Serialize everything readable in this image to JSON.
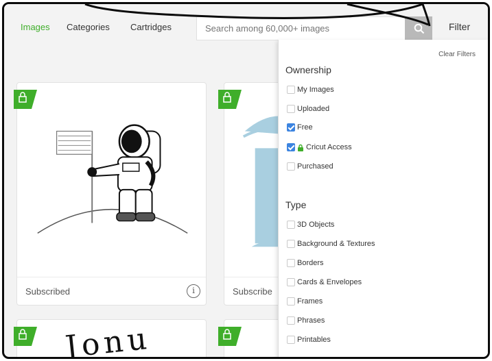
{
  "nav": {
    "tabs": [
      {
        "label": "Images",
        "active": true
      },
      {
        "label": "Categories",
        "active": false
      },
      {
        "label": "Cartridges",
        "active": false
      }
    ],
    "search_placeholder": "Search among 60,000+ images",
    "filter_label": "Filter",
    "search_icon": "search-icon"
  },
  "cards": [
    {
      "status": "Subscribed",
      "art": "astronaut-with-flag",
      "badge": "lock-icon"
    },
    {
      "status": "Subscribe",
      "art": "tree-illustration",
      "badge": "lock-icon"
    },
    {
      "status": "",
      "art": "lettering",
      "badge": "lock-icon"
    },
    {
      "status": "",
      "art": "unknown",
      "badge": "lock-icon"
    }
  ],
  "filters": {
    "clear_label": "Clear Filters",
    "ownership": {
      "title": "Ownership",
      "options": [
        {
          "label": "My Images",
          "checked": false
        },
        {
          "label": "Uploaded",
          "checked": false
        },
        {
          "label": "Free",
          "checked": true
        },
        {
          "label": "Cricut Access",
          "checked": true,
          "icon": "lock-icon"
        },
        {
          "label": "Purchased",
          "checked": false
        }
      ]
    },
    "type": {
      "title": "Type",
      "options": [
        {
          "label": "3D Objects",
          "checked": false
        },
        {
          "label": "Background & Textures",
          "checked": false
        },
        {
          "label": "Borders",
          "checked": false
        },
        {
          "label": "Cards & Envelopes",
          "checked": false
        },
        {
          "label": "Frames",
          "checked": false
        },
        {
          "label": "Phrases",
          "checked": false
        },
        {
          "label": "Printables",
          "checked": false
        }
      ]
    }
  },
  "colors": {
    "accent_green": "#3fae2a",
    "checkbox_blue": "#3c84e0",
    "art_blue": "#a9cfe0"
  },
  "art_text": {
    "lettering": "Jonu"
  }
}
